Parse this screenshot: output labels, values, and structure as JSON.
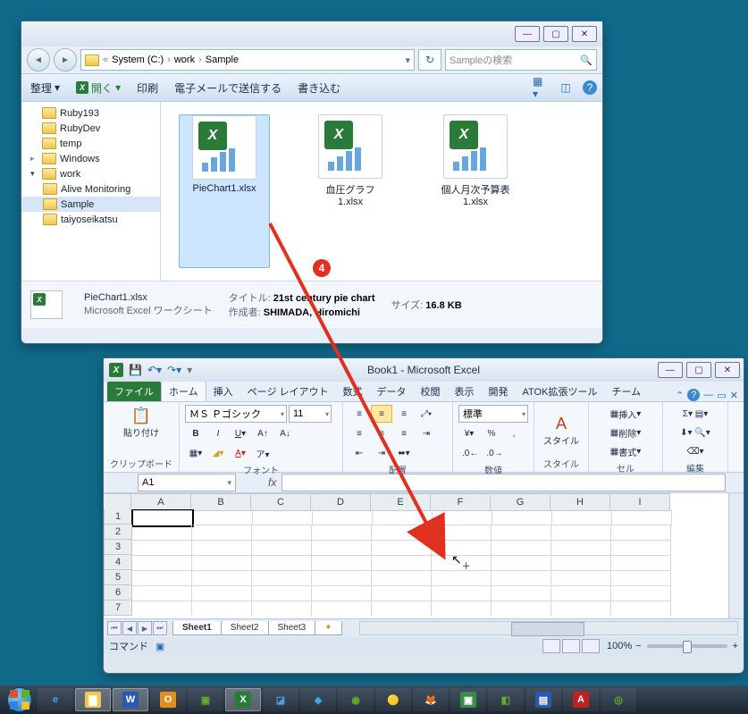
{
  "explorer": {
    "path_root": "«",
    "path1": "System (C:)",
    "path2": "work",
    "path3": "Sample",
    "search_placeholder": "Sampleの検索",
    "cmd": {
      "organize": "整理",
      "open": "開く",
      "print": "印刷",
      "email": "電子メールで送信する",
      "burn": "書き込む"
    },
    "tree": [
      "Ruby193",
      "RubyDev",
      "temp",
      "Windows",
      "work",
      "Alive Monitoring",
      "Sample",
      "taiyoseikatsu"
    ],
    "files": [
      {
        "name": "PieChart1.xlsx"
      },
      {
        "name": "血圧グラフ1.xlsx",
        "line1": "血圧グラフ",
        "line2": "1.xlsx"
      },
      {
        "name": "個人月次予算表1.xlsx",
        "line1": "個人月次予算表",
        "line2": "1.xlsx"
      }
    ],
    "detail": {
      "name": "PieChart1.xlsx",
      "type": "Microsoft Excel ワークシート",
      "title_label": "タイトル:",
      "title": "21st century pie chart",
      "author_label": "作成者:",
      "author": "SHIMADA, Hiromichi",
      "size_label": "サイズ:",
      "size": "16.8 KB"
    }
  },
  "excel": {
    "title": "Book1 - Microsoft Excel",
    "tabs": {
      "file": "ファイル",
      "home": "ホーム",
      "insert": "挿入",
      "layout": "ページ レイアウト",
      "formula": "数式",
      "data": "データ",
      "review": "校閲",
      "view": "表示",
      "dev": "開発",
      "atok": "ATOK拡張ツール",
      "team": "チーム"
    },
    "groups": {
      "clipboard": "クリップボード",
      "paste": "貼り付け",
      "font": "フォント",
      "align": "配置",
      "number": "数値",
      "style": "スタイル",
      "cells": "セル",
      "edit": "編集"
    },
    "font_name": "ＭＳ Ｐゴシック",
    "font_size": "11",
    "number_fmt": "標準",
    "cells_cmd": {
      "insert": "挿入",
      "delete": "削除",
      "format": "書式"
    },
    "name_box": "A1",
    "columns": [
      "A",
      "B",
      "C",
      "D",
      "E",
      "F",
      "G",
      "H",
      "I"
    ],
    "rows": [
      "1",
      "2",
      "3",
      "4",
      "5",
      "6",
      "7"
    ],
    "sheets": [
      "Sheet1",
      "Sheet2",
      "Sheet3"
    ],
    "status": "コマンド",
    "zoom": "100%"
  },
  "annotation": {
    "num": "4"
  }
}
